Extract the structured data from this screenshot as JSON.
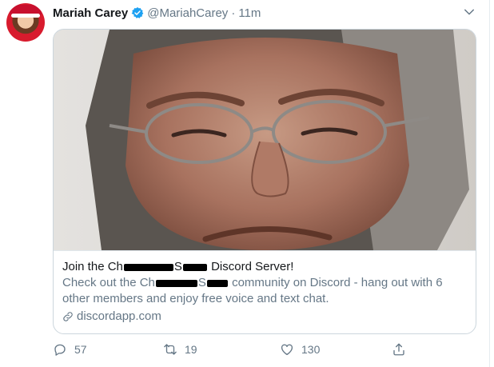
{
  "tweet": {
    "author_name": "Mariah Carey",
    "handle": "@MariahCarey",
    "separator": "·",
    "timestamp": "11m",
    "verified": true
  },
  "card": {
    "title_before": "Join the Ch",
    "title_after": "Discord Server!",
    "title_redacted_fragment": "S",
    "desc_line1_before": "Check out the Ch",
    "desc_line1_mid": "S",
    "desc_line1_after": "community on Discord - hang out with 6",
    "desc_line2": "other members and enjoy free voice and text chat.",
    "link_text": "discordapp.com"
  },
  "actions": {
    "replies": "57",
    "retweets": "19",
    "likes": "130"
  },
  "icons": {
    "verified": "verified-badge-icon",
    "chevron": "chevron-down-icon",
    "link": "link-icon",
    "reply": "reply-icon",
    "retweet": "retweet-icon",
    "like": "like-icon",
    "share": "share-icon"
  },
  "colors": {
    "accent": "#1da1f2",
    "text": "#14171a",
    "muted": "#657786",
    "border": "#ccd6dd"
  }
}
